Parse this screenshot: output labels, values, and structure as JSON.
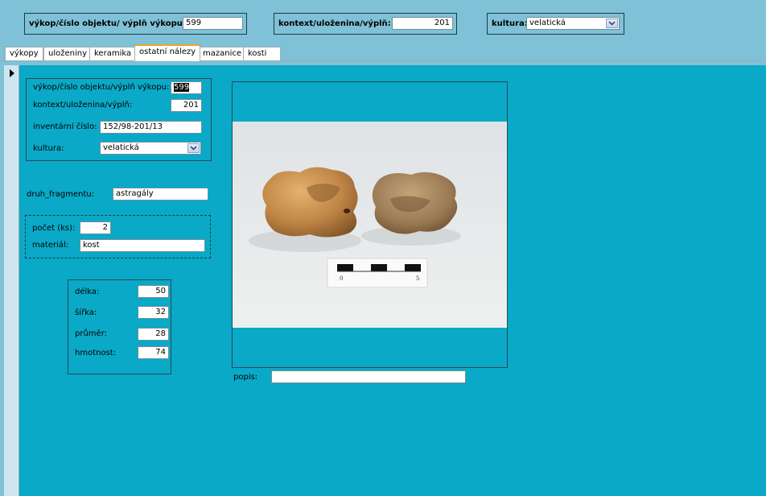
{
  "header": {
    "vykop_label": "výkop/číslo objektu/ výplň výkopu:",
    "vykop_value": "599",
    "kontext_label": "kontext/uloženina/výplň:",
    "kontext_value": "201",
    "kultura_label": "kultura:",
    "kultura_value": "velatická"
  },
  "tabs": [
    {
      "label": "výkopy"
    },
    {
      "label": "uloženiny"
    },
    {
      "label": "keramika"
    },
    {
      "label": "ostatní nálezy"
    },
    {
      "label": "mazanice"
    },
    {
      "label": "kosti"
    }
  ],
  "form": {
    "vykop_label": "výkop/číslo objektu/výplň výkopu:",
    "vykop_value": "599",
    "kontext_label": "kontext/uloženina/výplň:",
    "kontext_value": "201",
    "inventar_label": "inventární číslo:",
    "inventar_value": "152/98-201/13",
    "kultura_label": "kultura:",
    "kultura_value": "velatická",
    "druh_label": "druh_fragmentu:",
    "druh_value": "astragály",
    "pocet_label": "počet (ks):",
    "pocet_value": "2",
    "material_label": "materiál:",
    "material_value": "kost",
    "delka_label": "délka:",
    "delka_value": "50",
    "sirka_label": "šířka:",
    "sirka_value": "32",
    "prumer_label": "průměr:",
    "prumer_value": "28",
    "hmotnost_label": "hmotnost:",
    "hmotnost_value": "74",
    "popis_label": "popis:",
    "popis_value": ""
  },
  "photo": {
    "scale_0": "0",
    "scale_5": "5"
  },
  "colors": {
    "header_bg": "#7fc1d6",
    "form_bg": "#0aa9c7",
    "selector_bg": "#cfe6ee"
  }
}
